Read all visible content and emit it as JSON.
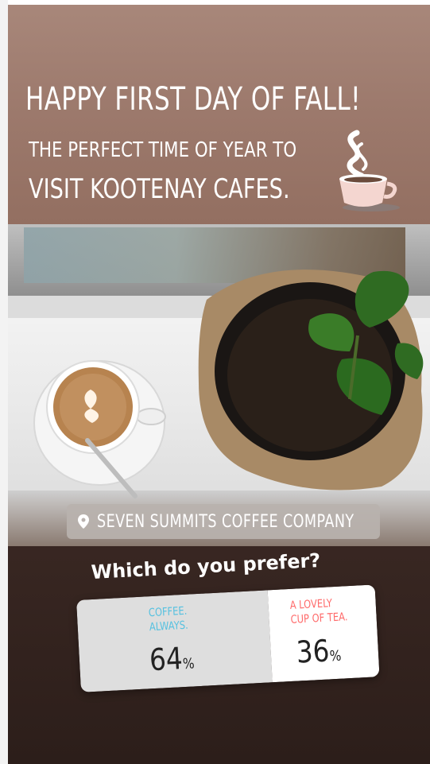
{
  "story": {
    "headline": "HAPPY FIRST DAY OF FALL!",
    "subline1": "THE PERFECT TIME OF YEAR TO",
    "subline2": "VISIT KOOTENAY CAFES.",
    "location": "SEVEN SUMMITS COFFEE COMPANY"
  },
  "poll": {
    "question": "Which do you prefer?",
    "options": [
      {
        "line1": "COFFEE.",
        "line2": "ALWAYS.",
        "percent": "64",
        "value": 0.64,
        "color": "#55c1e0"
      },
      {
        "line1": "A LOVELY",
        "line2": "CUP OF TEA.",
        "percent": "36",
        "value": 0.36,
        "color": "#ff6a6a"
      }
    ],
    "percent_sign": "%"
  },
  "colors": {
    "top_bg": "#9d7a6d",
    "bottom_bg": "#2c1e1a",
    "text": "#ffffff"
  }
}
